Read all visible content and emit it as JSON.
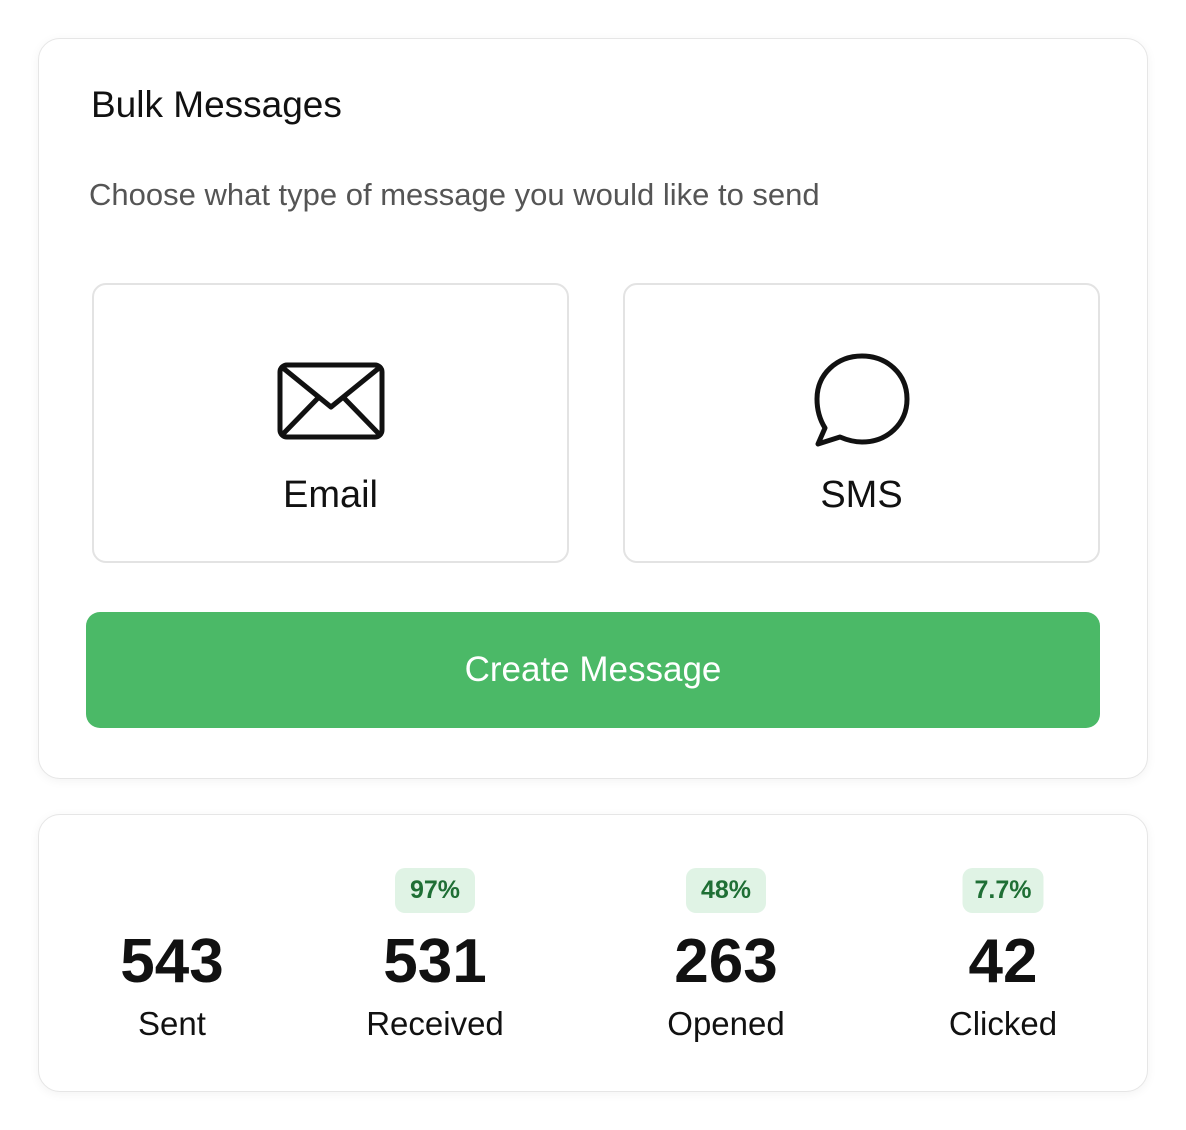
{
  "bulk_messages": {
    "title": "Bulk Messages",
    "subtitle": "Choose what type of message you would like to send",
    "options": [
      {
        "label": "Email",
        "icon": "envelope-icon"
      },
      {
        "label": "SMS",
        "icon": "chat-bubble-icon"
      }
    ],
    "create_button_label": "Create Message"
  },
  "stats": [
    {
      "value": "543",
      "label": "Sent",
      "percent": ""
    },
    {
      "value": "531",
      "label": "Received",
      "percent": "97%"
    },
    {
      "value": "263",
      "label": "Opened",
      "percent": "48%"
    },
    {
      "value": "42",
      "label": "Clicked",
      "percent": "7.7%"
    }
  ],
  "colors": {
    "accent": "#4bb967",
    "badge_bg": "#e0f3e5",
    "badge_text": "#1f6f35"
  }
}
